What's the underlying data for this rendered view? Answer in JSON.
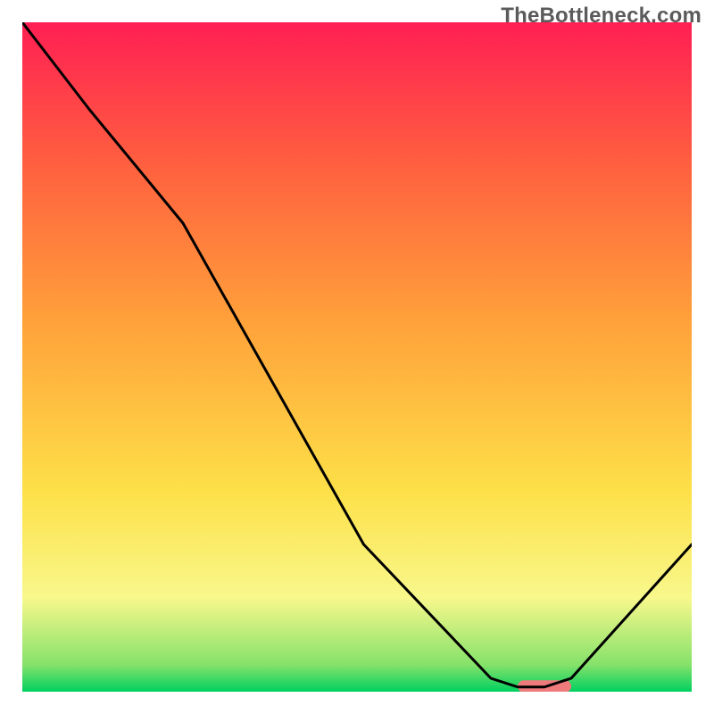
{
  "watermark": "TheBottleneck.com",
  "chart_data": {
    "type": "line",
    "title": "",
    "xlabel": "",
    "ylabel": "",
    "xlim": [
      0,
      100
    ],
    "ylim": [
      0,
      100
    ],
    "grid": false,
    "background_gradient": {
      "stops": [
        {
          "offset": 0.0,
          "color": "#00d060"
        },
        {
          "offset": 0.04,
          "color": "#85e26a"
        },
        {
          "offset": 0.14,
          "color": "#f8f88c"
        },
        {
          "offset": 0.3,
          "color": "#fde048"
        },
        {
          "offset": 0.55,
          "color": "#ffa23a"
        },
        {
          "offset": 0.78,
          "color": "#ff623f"
        },
        {
          "offset": 1.0,
          "color": "#ff1f53"
        }
      ]
    },
    "series": [
      {
        "name": "curve",
        "stroke": "#000000",
        "x": [
          0,
          10,
          24,
          51,
          70,
          74,
          78,
          82,
          100
        ],
        "y": [
          100,
          87,
          70,
          22,
          2,
          0.7,
          0.7,
          2,
          22
        ]
      }
    ],
    "marker": {
      "name": "sweet-spot",
      "color": "#ef7a7c",
      "x_start": 74,
      "x_end": 82,
      "y": 0.8,
      "thickness_pct": 1.8
    }
  }
}
